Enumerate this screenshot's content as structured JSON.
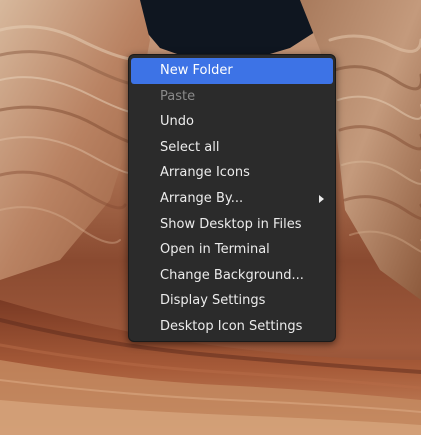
{
  "context_menu": {
    "items": [
      {
        "label": "New Folder",
        "state": "highlighted"
      },
      {
        "label": "Paste",
        "state": "disabled"
      },
      {
        "label": "Undo",
        "state": "normal"
      },
      {
        "label": "Select all",
        "state": "normal"
      },
      {
        "label": "Arrange Icons",
        "state": "normal"
      },
      {
        "label": "Arrange By...",
        "state": "normal",
        "submenu": true
      },
      {
        "label": "Show Desktop in Files",
        "state": "normal"
      },
      {
        "label": "Open in Terminal",
        "state": "normal"
      },
      {
        "label": "Change Background...",
        "state": "normal"
      },
      {
        "label": "Display Settings",
        "state": "normal"
      },
      {
        "label": "Desktop Icon Settings",
        "state": "normal"
      }
    ]
  },
  "colors": {
    "menu_background": "#2b2b2b",
    "highlight": "#3d73e6",
    "text": "#ececec",
    "disabled_text": "#8a8a8a",
    "sky": "#101822"
  }
}
